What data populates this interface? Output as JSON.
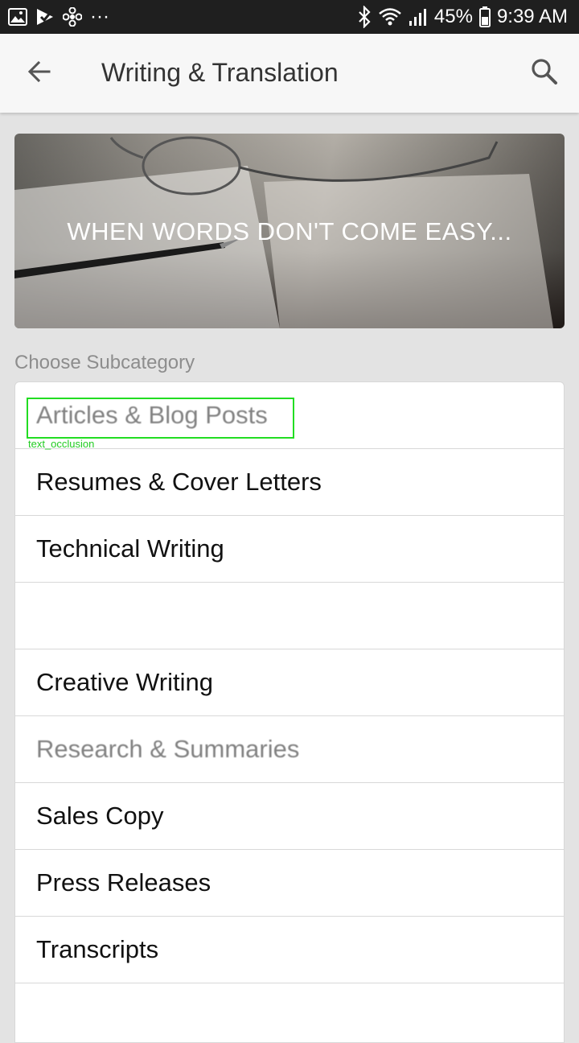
{
  "status_bar": {
    "battery": "45%",
    "time": "9:39 AM",
    "more": "···",
    "icons": [
      "gallery-icon",
      "check-icon",
      "fan-icon",
      "bluetooth-icon",
      "wifi-icon",
      "signal-icon",
      "battery-icon"
    ]
  },
  "app_bar": {
    "title": "Writing & Translation",
    "back_icon": "back-arrow-icon",
    "search_icon": "search-icon"
  },
  "banner": {
    "text": "WHEN WORDS DON'T COME EASY..."
  },
  "section": {
    "label": "Choose Subcategory"
  },
  "subcategories": [
    {
      "label": "Articles & Blog Posts"
    },
    {
      "label": "Resumes & Cover Letters"
    },
    {
      "label": "Technical Writing"
    },
    {
      "label": ""
    },
    {
      "label": "Creative Writing"
    },
    {
      "label": "Research & Summaries"
    },
    {
      "label": "Sales Copy"
    },
    {
      "label": "Press Releases"
    },
    {
      "label": "Transcripts"
    },
    {
      "label": ""
    }
  ],
  "annotation": {
    "label": "text_occlusion",
    "color": "#22dd22"
  }
}
